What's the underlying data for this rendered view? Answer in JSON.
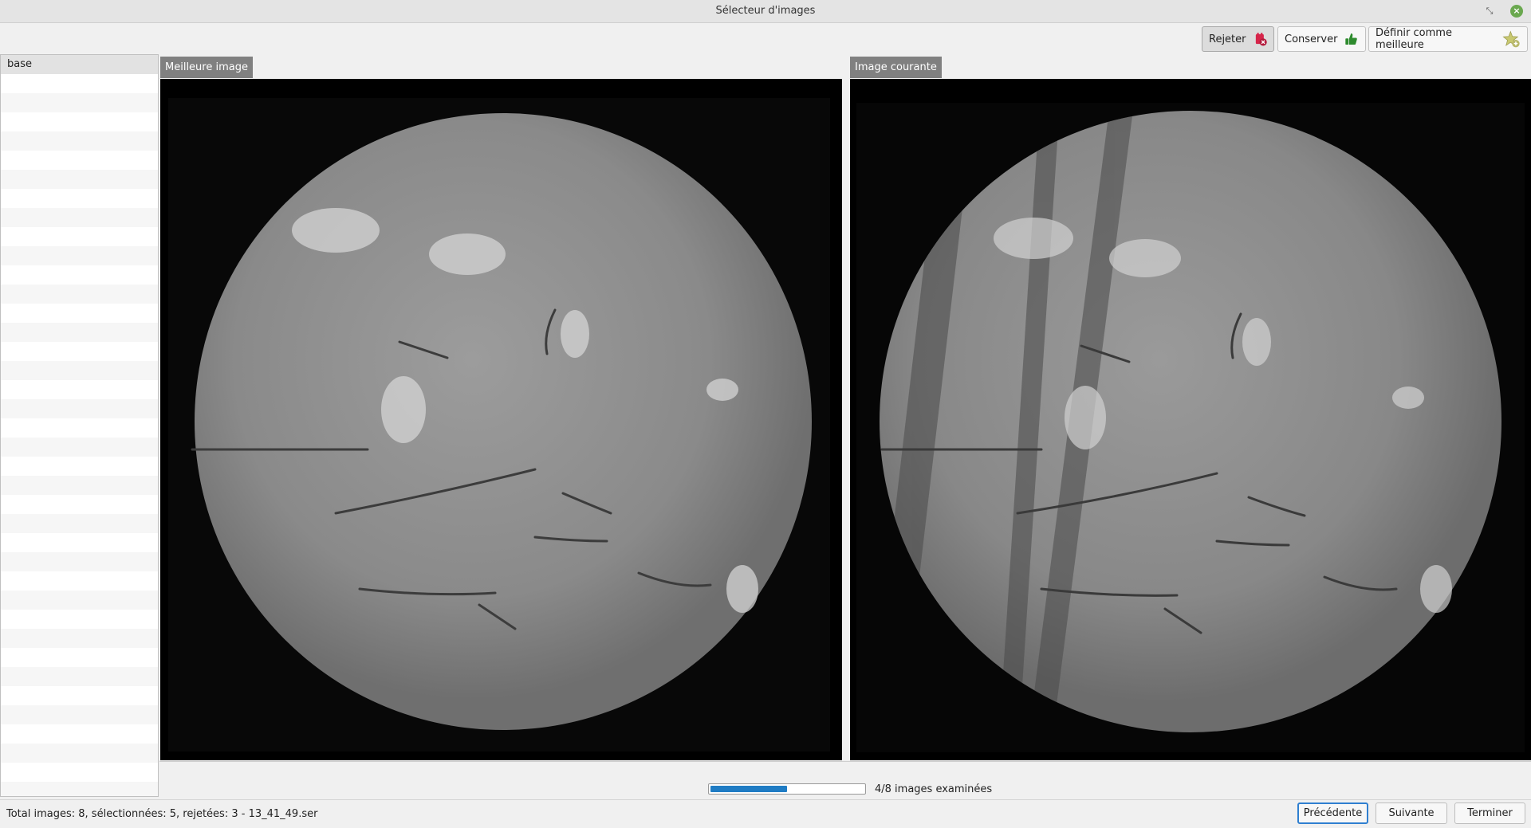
{
  "window": {
    "title": "Sélecteur d'images",
    "restore_glyph": "⤡",
    "close_glyph": "×"
  },
  "toolbar": {
    "reject_label": "Rejeter",
    "reject_icon": "cross-badge-icon",
    "reject_color": "#d6254a",
    "keep_label": "Conserver",
    "keep_icon": "thumbs-up-icon",
    "keep_color": "#2e8b2e",
    "best_label": "Définir comme meilleure",
    "best_icon": "star-plus-icon",
    "best_color": "#c8c870"
  },
  "sidebar": {
    "header": "base"
  },
  "panels": {
    "best_label": "Meilleure image",
    "current_label": "Image courante"
  },
  "progress": {
    "fraction": 0.5,
    "label": "4/8 images examinées",
    "color": "#1f7cc4"
  },
  "status": {
    "text": "Total images: 8, sélectionnées: 5, rejetées: 3 - 13_41_49.ser"
  },
  "nav": {
    "previous_label": "Précédente",
    "next_label": "Suivante",
    "finish_label": "Terminer"
  }
}
